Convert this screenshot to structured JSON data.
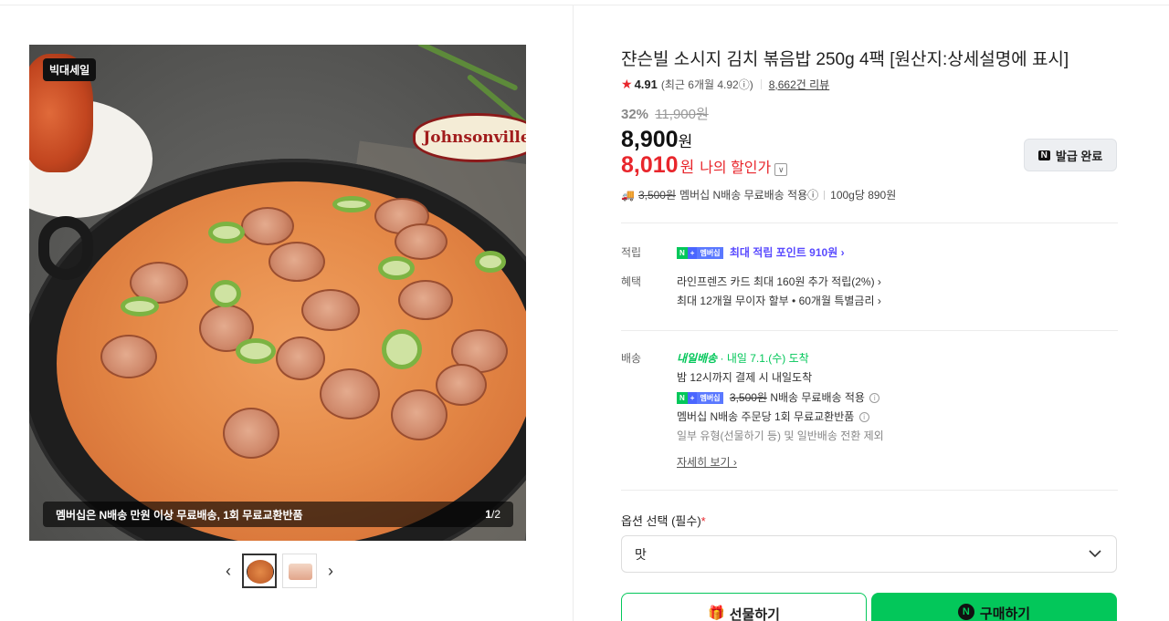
{
  "gallery": {
    "badge": "빅대세일",
    "brand_logo_text": "Johnsonville",
    "caption": "멤버십은 N배송 만원 이상 무료배송, 1회 무료교환반품",
    "pager_current": "1",
    "pager_total": "/2",
    "prev_icon": "‹",
    "next_icon": "›",
    "thumbnail_count": 2,
    "selected_thumbnail": 1
  },
  "product": {
    "title": "쟌슨빌 소시지 김치 볶음밥 250g 4팩 [원산지:상세설명에 표시]",
    "rating": "4.91",
    "recent_rating": "(최근 6개월 4.92ⓘ)",
    "review_count": "8,662건 리뷰",
    "discount_pct": "32%",
    "original_price": "11,900원",
    "price": "8,900",
    "price_unit": "원",
    "my_price": "8,010",
    "my_price_unit": "원",
    "my_price_label": "나의 할인가",
    "coupon_label": "발급 완료",
    "shipping_fee": "3,500원",
    "shipping_note": "멤버십 N배송 무료배송 적용ⓘ",
    "unit_price": "100g당 890원"
  },
  "benefits": {
    "points_label": "적립",
    "badge_n": "N",
    "badge_plus": "+",
    "badge_member": "멤버십",
    "points_text": "최대 적립 포인트 910원 ›",
    "benefit_label": "혜택",
    "benefit_line1": "라인프렌즈 카드 최대 160원 추가 적립(2%) ›",
    "benefit_line2": "최대 12개월 무이자 할부 • 60개월 특별금리 ›"
  },
  "delivery": {
    "label": "배송",
    "brand": "내일배송",
    "arrival": "· 내일 7.1.(수) 도착",
    "cutoff": "밤 12시까지 결제 시 내일도착",
    "fee_strike": "3,500원",
    "fee_note": "N배송 무료배송 적용",
    "exchange": "멤버십 N배송 주문당 1회 무료교환반품",
    "exclusion": "일부 유형(선물하기 등) 및 일반배송 전환 제외",
    "more": "자세히 보기 ›"
  },
  "option": {
    "label": "옵션 선택 (필수)",
    "required_mark": "*",
    "selected": "맛"
  },
  "actions": {
    "gift": "선물하기",
    "buy": "구매하기"
  },
  "colors": {
    "accent_red": "#e8262c",
    "naver_green": "#03c75a",
    "point_purple": "#5a4bff"
  }
}
